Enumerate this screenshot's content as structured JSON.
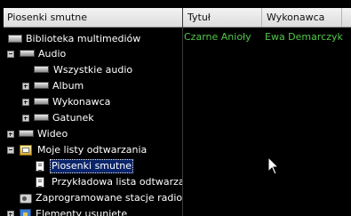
{
  "tree": {
    "header": "Piosenki smutne",
    "items": [
      {
        "label": "Biblioteka multimediów",
        "icon": "library-icon"
      },
      {
        "label": "Audio",
        "icon": "audio-icon",
        "expander": "collapse"
      },
      {
        "label": "Wszystkie audio",
        "icon": "audio-icon"
      },
      {
        "label": "Album",
        "icon": "album-icon",
        "expander": "expand"
      },
      {
        "label": "Wykonawca",
        "icon": "artist-icon",
        "expander": "expand"
      },
      {
        "label": "Gatunek",
        "icon": "genre-icon",
        "expander": "expand"
      },
      {
        "label": "Wideo",
        "icon": "video-icon",
        "expander": "expand"
      },
      {
        "label": "Moje listy odtwarzania",
        "icon": "playlists-folder-icon",
        "expander": "collapse"
      },
      {
        "label": "Piosenki smutne",
        "icon": "playlist-icon",
        "selected": true
      },
      {
        "label": "Przykładowa lista odtwarzania",
        "icon": "playlist-icon"
      },
      {
        "label": "Zaprogramowane stacje radiowe",
        "icon": "radio-icon"
      },
      {
        "label": "Elementy usunięte",
        "icon": "recycle-bin-icon",
        "expander": "expand"
      }
    ]
  },
  "list": {
    "columns": [
      "Tytuł",
      "Wykonawca"
    ],
    "rows": [
      {
        "title": "Czarne Anioły",
        "artist": "Ewa Demarczyk"
      }
    ]
  },
  "colors": {
    "background": "#000000",
    "selection": "#0a246a",
    "row_text": "#52c64a"
  }
}
